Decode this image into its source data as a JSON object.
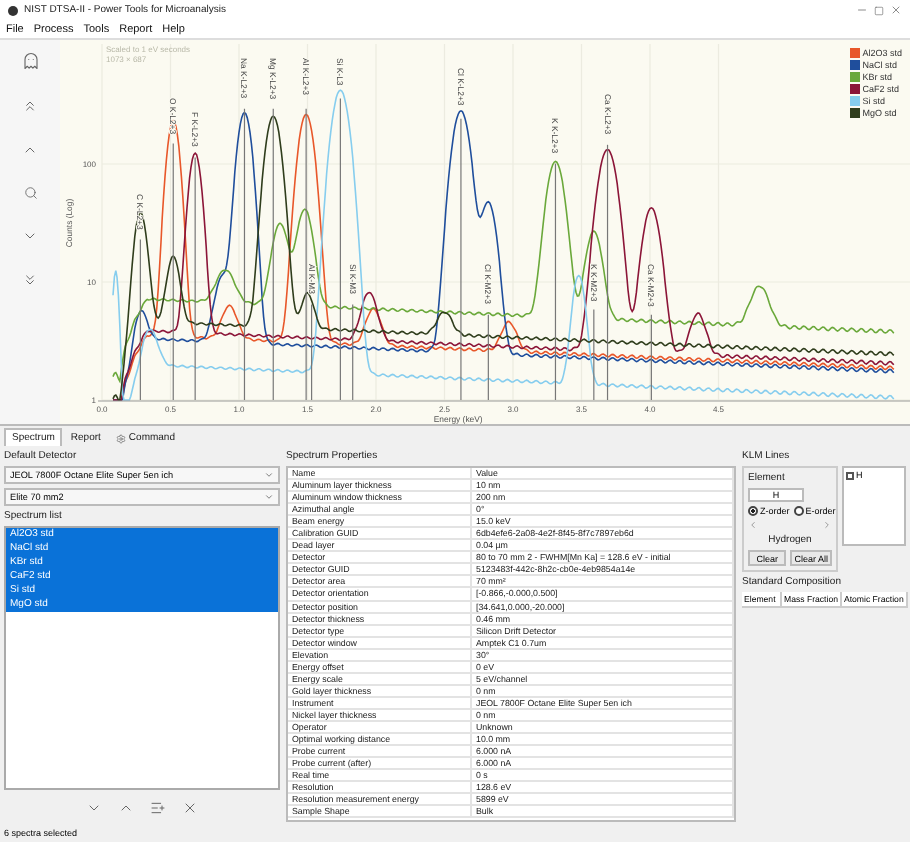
{
  "window": {
    "title": "NIST DTSA-II - Power Tools for Microanalysis"
  },
  "menu": [
    "File",
    "Process",
    "Tools",
    "Report",
    "Help"
  ],
  "plot": {
    "caption": [
      "Scaled to 1 eV seconds",
      "1073 × 687"
    ],
    "y_label": "Counts (Log)",
    "x_label": "Energy (keV)",
    "y_ticks": [
      "100",
      "10",
      "1"
    ],
    "x_ticks": [
      "0.0",
      "0.5",
      "1.0",
      "1.5",
      "2.0",
      "2.5",
      "3.0",
      "3.5",
      "4.0",
      "4.5"
    ],
    "markers": [
      {
        "label": "C K-L2+3"
      },
      {
        "label": "O K-L2+3"
      },
      {
        "label": "F K-L2+3"
      },
      {
        "label": "Na K-L2+3"
      },
      {
        "label": "Mg K-L2+3"
      },
      {
        "label": "Al K-L2+3"
      },
      {
        "label": "Si K-L3"
      },
      {
        "label": "Cl K-L2+3"
      },
      {
        "label": "K K-L2+3"
      },
      {
        "label": "Ca K-L2+3"
      },
      {
        "label": "Al K-M3"
      },
      {
        "label": "Si K-M3"
      },
      {
        "label": "Cl K-M2+3"
      },
      {
        "label": "K K-M2+3"
      },
      {
        "label": "Ca K-M2+3"
      }
    ],
    "legend": [
      {
        "name": "Al2O3 std",
        "color": "#e8572a"
      },
      {
        "name": "NaCl std",
        "color": "#1f4e9c"
      },
      {
        "name": "KBr std",
        "color": "#6aa83a"
      },
      {
        "name": "CaF2 std",
        "color": "#8b1538"
      },
      {
        "name": "Si std",
        "color": "#86cdee"
      },
      {
        "name": "MgO std",
        "color": "#2f3d1c"
      }
    ]
  },
  "tabs": [
    {
      "label": "Spectrum",
      "selected": true
    },
    {
      "label": "Report",
      "selected": false
    },
    {
      "label": "Command",
      "selected": false
    }
  ],
  "detector": {
    "label": "Default Detector",
    "instrument": "JEOL 7800F Octane Elite Super 5en ich",
    "detector": "Elite 70 mm2"
  },
  "spectrum_list": {
    "label": "Spectrum list",
    "items": [
      {
        "name": "Al2O3 std",
        "selected": true
      },
      {
        "name": "NaCl std",
        "selected": true
      },
      {
        "name": "KBr std",
        "selected": true
      },
      {
        "name": "CaF2 std",
        "selected": true
      },
      {
        "name": "Si std",
        "selected": true
      },
      {
        "name": "MgO std",
        "selected": true
      }
    ]
  },
  "properties": {
    "title": "Spectrum Properties",
    "columns": [
      "Name",
      "Value"
    ],
    "rows": [
      [
        "Aluminum layer thickness",
        "10 nm"
      ],
      [
        "Aluminum window thickness",
        "200 nm"
      ],
      [
        "Azimuthal angle",
        "0°"
      ],
      [
        "Beam energy",
        "15.0 keV"
      ],
      [
        "Calibration GUID",
        "6db4efe6-2a08-4e2f-8f45-8f7c7897eb6d"
      ],
      [
        "Dead layer",
        "0.04 µm"
      ],
      [
        "Detector",
        "80 to 70 mm 2 - FWHM[Mn Ka] = 128.6 eV - initial"
      ],
      [
        "Detector GUID",
        "5123483f-442c-8h2c-cb0e-4eb9854a14e"
      ],
      [
        "Detector area",
        "70 mm²"
      ],
      [
        "Detector orientation",
        "[-0.866,-0.000,0.500]"
      ],
      [
        "Detector position",
        "[34.641,0.000,-20.000]"
      ],
      [
        "Detector thickness",
        "0.46 mm"
      ],
      [
        "Detector type",
        "Silicon Drift Detector"
      ],
      [
        "Detector window",
        "Amptek C1 0.7um"
      ],
      [
        "Elevation",
        "30°"
      ],
      [
        "Energy offset",
        "0 eV"
      ],
      [
        "Energy scale",
        "5 eV/channel"
      ],
      [
        "Gold layer thickness",
        "0 nm"
      ],
      [
        "Instrument",
        "JEOL 7800F Octane Elite Super 5en ich"
      ],
      [
        "Nickel layer thickness",
        "0 nm"
      ],
      [
        "Operator",
        "Unknown"
      ],
      [
        "Optimal working distance",
        "10.0 mm"
      ],
      [
        "Probe current",
        "6.000 nA"
      ],
      [
        "Probe current (after)",
        "6.000 nA"
      ],
      [
        "Real time",
        "0 s"
      ],
      [
        "Resolution",
        "128.6 eV"
      ],
      [
        "Resolution measurement energy",
        "5899 eV"
      ],
      [
        "Sample Shape",
        "Bulk"
      ]
    ]
  },
  "klm": {
    "title": "KLM Lines",
    "element_label": "Element",
    "element_value": "H",
    "orders": [
      {
        "label": "Z-order",
        "selected": true
      },
      {
        "label": "E-order",
        "selected": false
      }
    ],
    "element_name": "Hydrogen",
    "buttons": [
      "Clear",
      "Clear All"
    ],
    "lines": [
      {
        "label": "H",
        "checked": false
      }
    ]
  },
  "composition": {
    "title": "Standard Composition",
    "columns": [
      "Element",
      "Mass Fraction",
      "Atomic Fraction"
    ]
  },
  "status_bar": "6 spectra selected"
}
